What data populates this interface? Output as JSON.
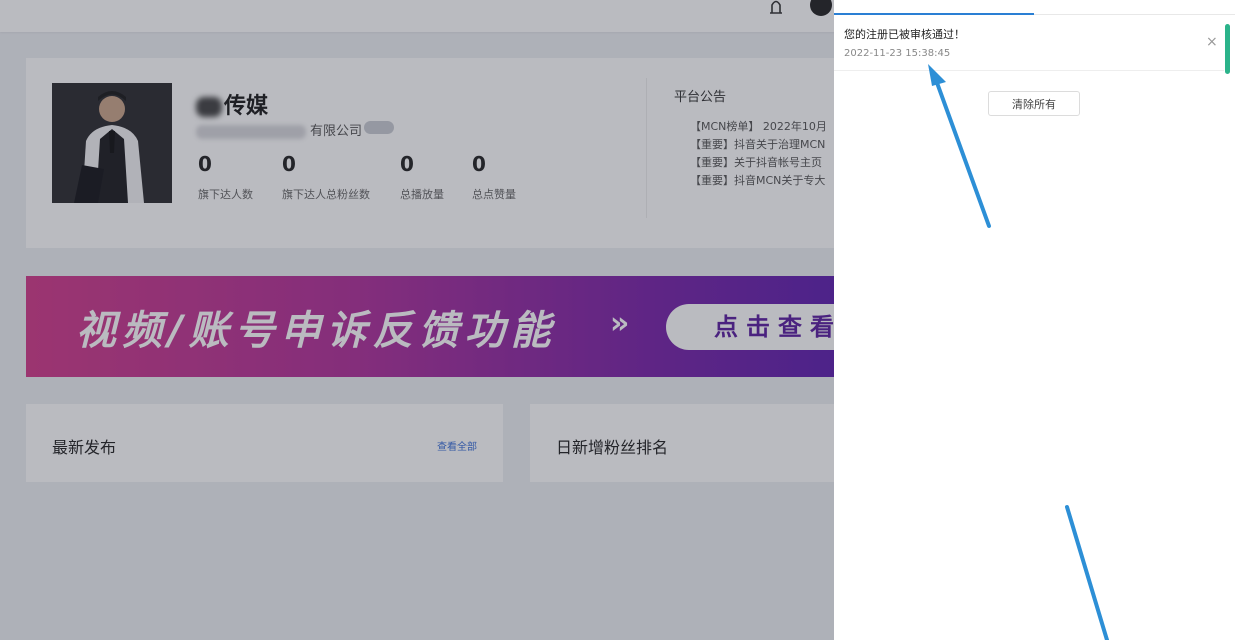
{
  "topbar": {
    "bell_icon": "bell-icon",
    "avatar_icon": "user-avatar"
  },
  "profile": {
    "company_name": "传媒",
    "company_legal": "有限公司",
    "stats": [
      {
        "value": "0",
        "label": "旗下达人数"
      },
      {
        "value": "0",
        "label": "旗下达人总粉丝数"
      },
      {
        "value": "0",
        "label": "总播放量"
      },
      {
        "value": "0",
        "label": "总点赞量"
      }
    ]
  },
  "announcements": {
    "title": "平台公告",
    "items": [
      "【MCN榜单】 2022年10月",
      "【重要】抖音关于治理MCN",
      "【重要】关于抖音帐号主页",
      "【重要】抖音MCN关于专大"
    ]
  },
  "banner": {
    "text": "视频/账号申诉反馈功能",
    "arrows": "»",
    "button": "点击查看"
  },
  "cards": {
    "latest": {
      "title": "最新发布",
      "link": "查看全部"
    },
    "ranking": {
      "title": "日新增粉丝排名"
    }
  },
  "drawer": {
    "message": {
      "text": "您的注册已被审核通过！",
      "time": "2022-11-23 15:38:45"
    },
    "clear_button": "清除所有"
  },
  "colors": {
    "accent": "#2a7fd4",
    "scrollbar": "#2bb38a",
    "banner_start": "#d23a8a",
    "banner_end": "#5c1fb0",
    "arrow": "#2d8fd6"
  }
}
